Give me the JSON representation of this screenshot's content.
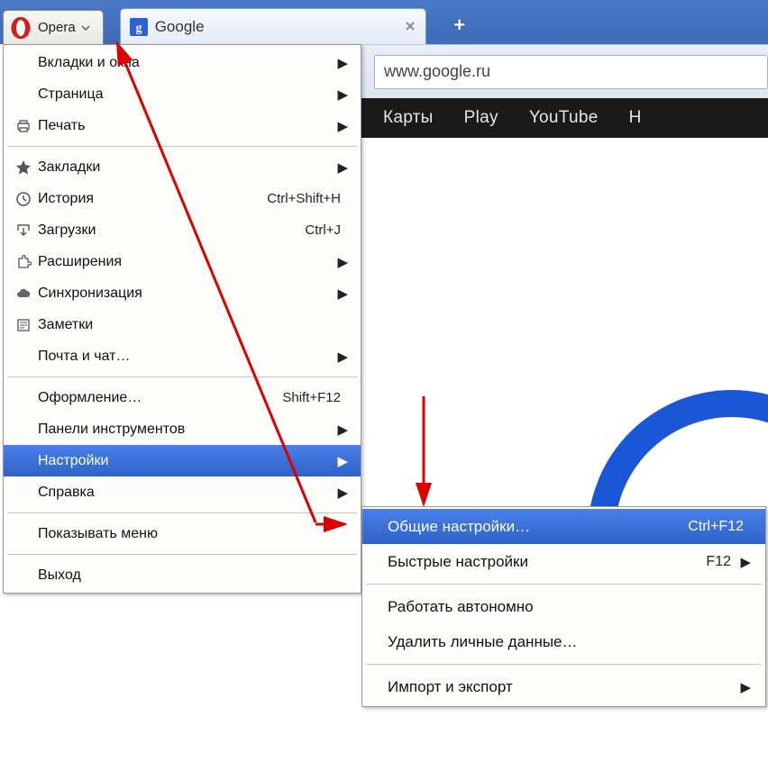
{
  "app": {
    "opera_label": "Opera"
  },
  "tab": {
    "title": "Google"
  },
  "address": {
    "url": "www.google.ru"
  },
  "nav": {
    "maps": "Карты",
    "play": "Play",
    "youtube": "YouTube",
    "news": "Н"
  },
  "menu": {
    "tabs_windows": "Вкладки и окна",
    "page": "Страница",
    "print": "Печать",
    "bookmarks": "Закладки",
    "history": "История",
    "history_sc": "Ctrl+Shift+H",
    "downloads": "Загрузки",
    "downloads_sc": "Ctrl+J",
    "extensions": "Расширения",
    "sync": "Синхронизация",
    "notes": "Заметки",
    "mail_chat": "Почта и чат…",
    "appearance": "Оформление…",
    "appearance_sc": "Shift+F12",
    "toolbars": "Панели инструментов",
    "settings": "Настройки",
    "help": "Справка",
    "show_menu": "Показывать меню",
    "exit": "Выход"
  },
  "submenu": {
    "general": "Общие настройки…",
    "general_sc": "Ctrl+F12",
    "quick": "Быстрые настройки",
    "quick_sc": "F12",
    "offline": "Работать автономно",
    "delete_private": "Удалить личные данные…",
    "import_export": "Импорт и экспорт"
  }
}
